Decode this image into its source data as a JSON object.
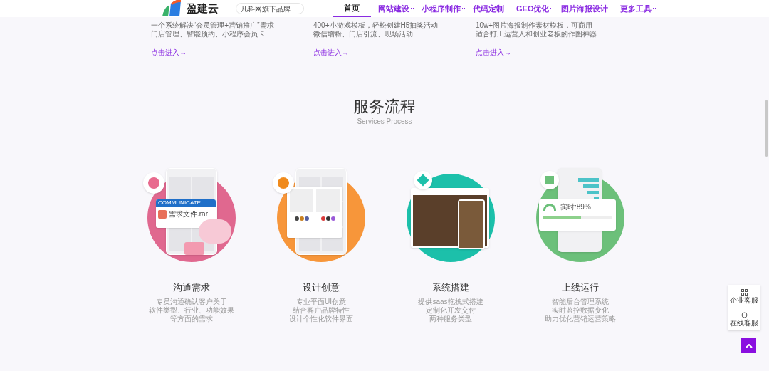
{
  "header": {
    "brand": "盈建云",
    "search": {
      "placeholder": "凡科网旗下品牌"
    },
    "nav": [
      {
        "label": "首页",
        "selected": true,
        "dropdown": false
      },
      {
        "label": "网站建设",
        "selected": false,
        "dropdown": true
      },
      {
        "label": "小程序制作",
        "selected": false,
        "dropdown": true
      },
      {
        "label": "代码定制",
        "selected": false,
        "dropdown": true
      },
      {
        "label": "GEO优化",
        "selected": false,
        "dropdown": true
      },
      {
        "label": "图片海报设计",
        "selected": false,
        "dropdown": true
      },
      {
        "label": "更多工具",
        "selected": false,
        "dropdown": true
      }
    ]
  },
  "product_cards": [
    {
      "lines": [
        "一个系统解决“会员管理+营销推广”需求",
        "门店管理、智能预约、小程序会员卡"
      ],
      "link": "点击进入→"
    },
    {
      "lines": [
        "400+小游戏模板，轻松创建H5抽奖活动",
        "微信增粉、门店引流、现场活动"
      ],
      "link": "点击进入→"
    },
    {
      "lines": [
        "10w+图片海报制作素材模板，可商用",
        "适合打工运营人和创业老板的作图神器"
      ],
      "link": "点击进入→"
    }
  ],
  "process": {
    "title": "服务流程",
    "subtitle": "Services Process",
    "steps": [
      {
        "kind": "communicate",
        "color": "#e0688f",
        "title": "沟通需求",
        "lines": [
          "专员沟通确认客户关于",
          "软件类型、行业、功能效果",
          "等方面的需求"
        ],
        "card_header": "COMMUNICATE",
        "file_name": "需求文件.rar"
      },
      {
        "kind": "design",
        "color": "#f7963a",
        "title": "设计创意",
        "lines": [
          "专业平面UI创意",
          "结合客户品牌特性",
          "设计个性化软件界面"
        ]
      },
      {
        "kind": "build",
        "color": "#1cc0aa",
        "title": "系统搭建",
        "lines": [
          "提供saas拖拽式搭建",
          "定制化开发交付",
          "两种服务类型"
        ]
      },
      {
        "kind": "launch",
        "color": "#6cc07a",
        "title": "上线运行",
        "lines": [
          "智能后台管理系统",
          "实时监控数据变化",
          "助力优化营销运营策略"
        ],
        "reading": "实时:89%"
      }
    ]
  },
  "side_widgets": [
    {
      "kind": "grid",
      "label": "企业客服"
    },
    {
      "kind": "chat",
      "label": "在线客服"
    }
  ]
}
